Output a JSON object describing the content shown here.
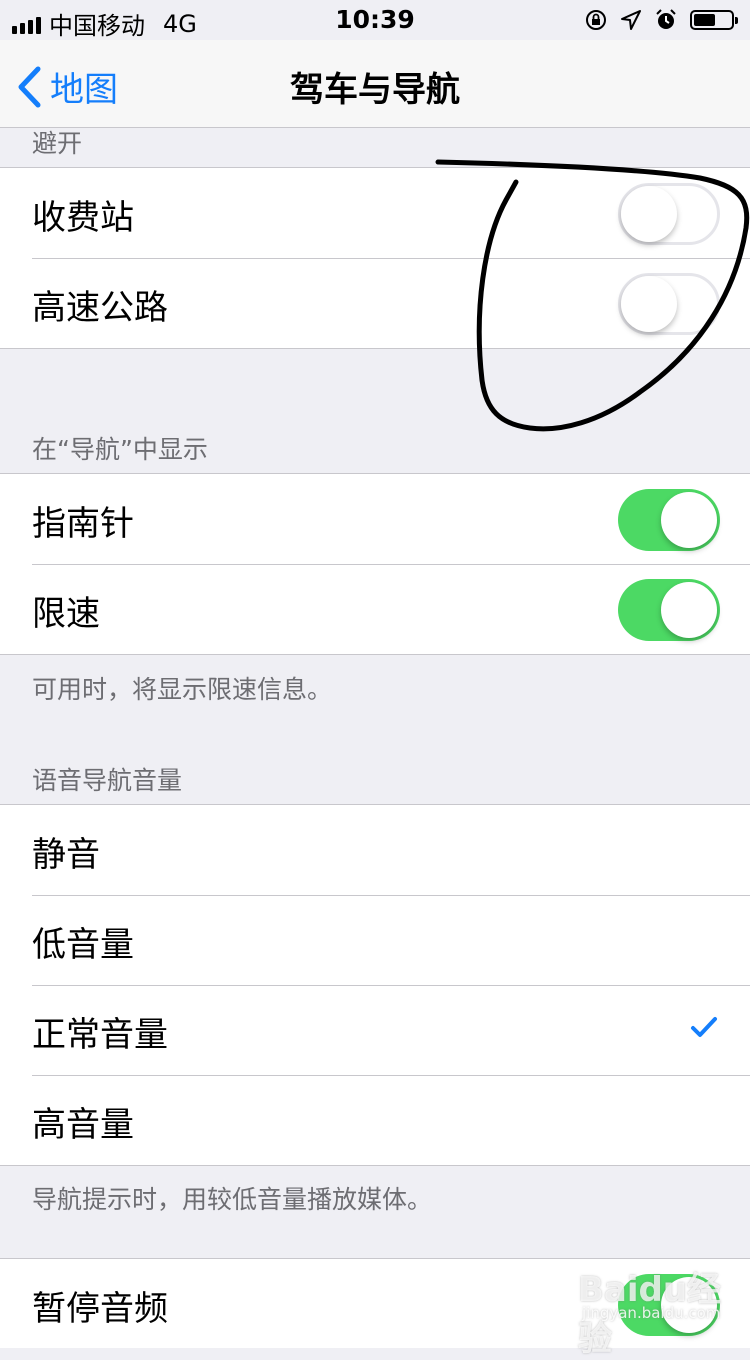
{
  "status_bar": {
    "carrier": "中国移动",
    "network": "4G",
    "time": "10:39",
    "icons": [
      "orientation-lock-icon",
      "location-arrow-icon",
      "alarm-icon",
      "battery-icon"
    ]
  },
  "nav": {
    "back_label": "地图",
    "title": "驾车与导航"
  },
  "avoid": {
    "header": "避开",
    "rows": [
      {
        "label": "收费站",
        "on": false
      },
      {
        "label": "高速公路",
        "on": false
      }
    ]
  },
  "show_in_nav": {
    "header": "在“导航”中显示",
    "rows": [
      {
        "label": "指南针",
        "on": true
      },
      {
        "label": "限速",
        "on": true
      }
    ],
    "footer": "可用时，将显示限速信息。"
  },
  "voice_volume": {
    "header": "语音导航音量",
    "options": [
      "静音",
      "低音量",
      "正常音量",
      "高音量"
    ],
    "selected": "正常音量",
    "footer": "导航提示时，用较低音量播放媒体。"
  },
  "pause_audio": {
    "label": "暂停音频",
    "on": true
  },
  "watermark": {
    "brand": "Baidu经验",
    "url": "jingyan.baidu.com"
  },
  "colors": {
    "accent": "#147efb",
    "toggle_on": "#4cd964",
    "annotation_ink": "#000000"
  }
}
